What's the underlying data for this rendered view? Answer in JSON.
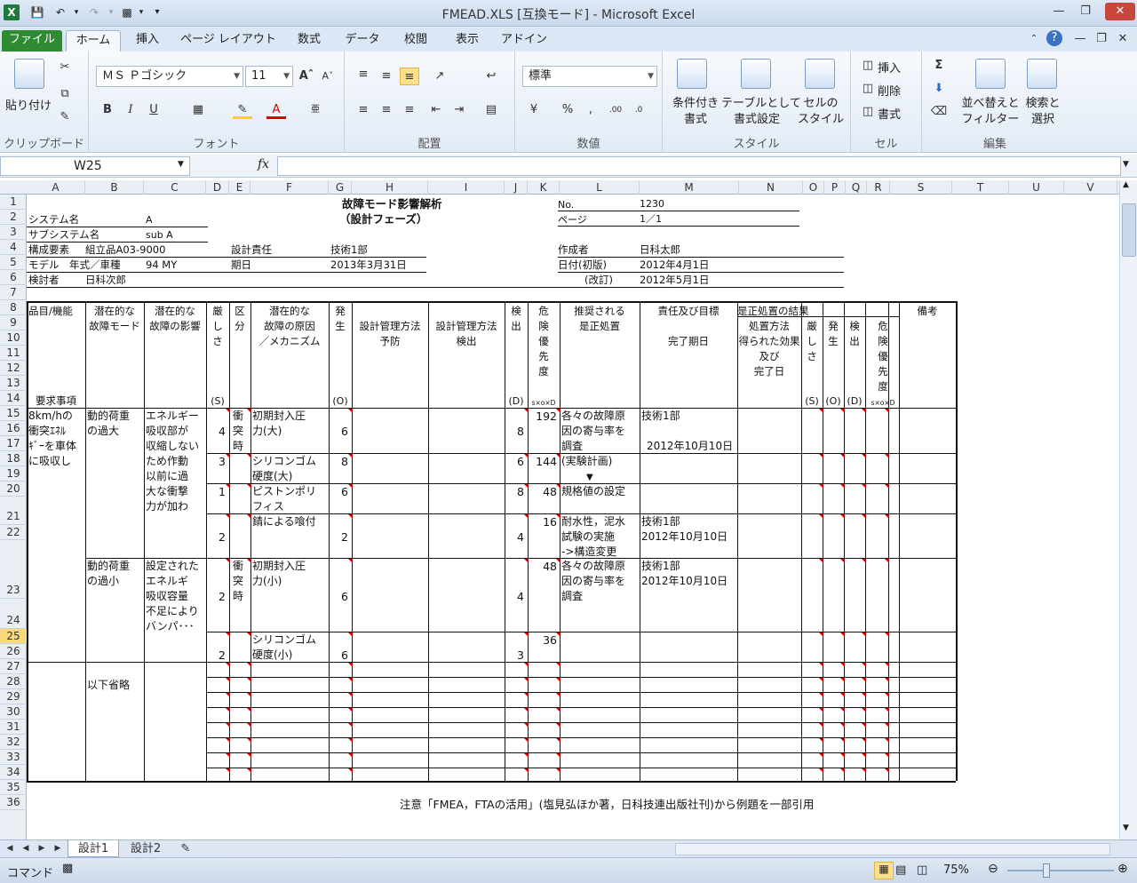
{
  "window": {
    "title": "FMEAD.XLS  [互換モード] - Microsoft Excel"
  },
  "ribbon": {
    "tabs": [
      "ファイル",
      "ホーム",
      "挿入",
      "ページ レイアウト",
      "数式",
      "データ",
      "校閲",
      "表示",
      "アドイン"
    ],
    "clipboard": {
      "paste": "貼り付け",
      "group": "クリップボード"
    },
    "font": {
      "name": "ＭＳ Ｐゴシック",
      "size": "11",
      "group": "フォント"
    },
    "alignment": {
      "group": "配置"
    },
    "number": {
      "format": "標準",
      "group": "数値"
    },
    "styles": {
      "conditional": [
        "条件付き",
        "書式"
      ],
      "table": [
        "テーブルとして",
        "書式設定"
      ],
      "cell": [
        "セルの",
        "スタイル"
      ],
      "group": "スタイル"
    },
    "cells": {
      "insert": "挿入",
      "delete": "削除",
      "format": "書式",
      "group": "セル"
    },
    "editing": {
      "sort": [
        "並べ替えと",
        "フィルター"
      ],
      "find": [
        "検索と",
        "選択"
      ],
      "group": "編集"
    }
  },
  "formula_bar": {
    "name_box": "W25",
    "fx": "fx",
    "content": ""
  },
  "columns": [
    "A",
    "B",
    "C",
    "D",
    "E",
    "F",
    "G",
    "H",
    "I",
    "J",
    "K",
    "L",
    "M",
    "N",
    "O",
    "P",
    "Q",
    "R",
    "S",
    "T",
    "U",
    "V"
  ],
  "rows": [
    "1",
    "2",
    "3",
    "4",
    "5",
    "6",
    "7",
    "8",
    "9",
    "10",
    "11",
    "12",
    "13",
    "14",
    "15",
    "16",
    "17",
    "18",
    "19",
    "20",
    "21",
    "22",
    "23",
    "24",
    "25",
    "26",
    "27",
    "28",
    "29",
    "30",
    "31",
    "32",
    "33",
    "34",
    "35",
    "36"
  ],
  "sheet": {
    "title1": "故障モード影響解析",
    "title2": "（設計フェーズ）",
    "no_label": "No.",
    "no_value": "1230",
    "page_label": "ページ",
    "page_value": "1／1",
    "system_label": "システム名",
    "system_value": "A",
    "subsystem_label": "サブシステム名",
    "subsystem_value": "sub A",
    "component_label": "構成要素",
    "component_value": "組立品A03-9000",
    "model_label": "モデル　年式／車種",
    "model_value": "94 MY",
    "responsible_label": "設計責任",
    "responsible_value": "技術1部",
    "date_label": "期日",
    "date_value": "2013年3月31日",
    "creator_label": "作成者",
    "creator_value": "日科太郎",
    "created_label": "日付(初版)",
    "created_value": "2012年4月1日",
    "revised_label": "(改訂)",
    "revised_value": "2012年5月1日",
    "reviewer_label": "検討者",
    "reviewer_value": "日科次郎",
    "note": "注意「FMEA，FTAの活用」(塩見弘ほか著，日科技連出版社刊)から例題を一部引用",
    "headers": {
      "item": "品目/機能",
      "requirement": "要求事項",
      "mode": [
        "潜在的な",
        "故障モード"
      ],
      "effect": [
        "潜在的な",
        "故障の影響"
      ],
      "severity": [
        "厳",
        "し",
        "さ",
        "(S)"
      ],
      "class": [
        "区",
        "分"
      ],
      "cause": [
        "潜在的な",
        "故障の原因",
        "／メカニズム"
      ],
      "occurrence": [
        "発",
        "生",
        "(O)"
      ],
      "prevent": [
        "設計管理方法",
        "予防"
      ],
      "detect": [
        "設計管理方法",
        "検出"
      ],
      "detection": [
        "検",
        "出",
        "(D)"
      ],
      "rpn": [
        "危",
        "険",
        "優",
        "先",
        "度",
        "s×o×D"
      ],
      "recommended": [
        "推奨される",
        "是正処置"
      ],
      "responsibility": [
        "責任及び目標",
        "完了期日"
      ],
      "results": "是正処置の結果",
      "action_taken": [
        "処置方法",
        "得られた効果",
        "及び",
        "完了日"
      ],
      "r_sev": [
        "厳",
        "し",
        "さ",
        "(S)"
      ],
      "r_occ": [
        "発",
        "生",
        "(O)"
      ],
      "r_det": [
        "検",
        "出",
        "(D)"
      ],
      "r_rpn": [
        "危",
        "険",
        "優",
        "先",
        "度",
        "s×o×D"
      ],
      "remarks": "備考"
    },
    "body": {
      "item": [
        "8km/hの",
        "衝突ｴﾈﾙ",
        "ｷﾞｰを車体",
        "に吸収し"
      ],
      "mode1": [
        "動的荷重",
        "の過大"
      ],
      "effect1": [
        "エネルギー",
        "吸収部が",
        "収縮しない",
        "ため作動",
        "以前に過",
        "大な衝撃",
        "力が加わ"
      ],
      "class1": [
        "衝",
        "突",
        "時"
      ],
      "cause1": [
        "初期封入圧",
        "力(大)"
      ],
      "s1": "4",
      "o1": "6",
      "d1": "8",
      "rpn1": "192",
      "cause2": [
        "シリコンゴム",
        "硬度(大)"
      ],
      "s2": "3",
      "o2": "8",
      "d2": "6",
      "rpn2": "144",
      "cause3": [
        "ピストンポリ",
        "フィス"
      ],
      "s3": "1",
      "o3": "6",
      "d3": "8",
      "rpn3": "48",
      "cause4": "錆による喰付",
      "s4": "2",
      "o4": "2",
      "d4": "4",
      "rpn4": "16",
      "rec1": [
        "各々の故障原",
        "因の寄与率を",
        "調査",
        "(実験計画)"
      ],
      "arrow": "▼",
      "rec1b": "規格値の設定",
      "resp1": "技術1部",
      "date1": "2012年10月10日",
      "rec2": [
        "耐水性，泥水",
        "試験の実施",
        "->構造変更"
      ],
      "resp2": "技術1部",
      "date2": "2012年10月10日",
      "mode2": [
        "動的荷重",
        "の過小"
      ],
      "effect2": [
        "設定された",
        "エネルギ",
        "吸収容量",
        "不足により",
        "バンパ･･･"
      ],
      "class2": [
        "衝",
        "突",
        "時"
      ],
      "cause5": [
        "初期封入圧",
        "力(小)"
      ],
      "s5": "2",
      "o5": "6",
      "d5": "4",
      "rpn5": "48",
      "rec3": [
        "各々の故障原",
        "因の寄与率を",
        "調査"
      ],
      "resp3": "技術1部",
      "date3": "2012年10月10日",
      "cause6": [
        "シリコンゴム",
        "硬度(小)"
      ],
      "s6": "2",
      "o6": "6",
      "d6": "3",
      "rpn6": "36",
      "omitted": "以下省略"
    }
  },
  "sheet_tabs": [
    "設計1",
    "設計2"
  ],
  "status": {
    "mode": "コマンド",
    "zoom": "75%"
  }
}
